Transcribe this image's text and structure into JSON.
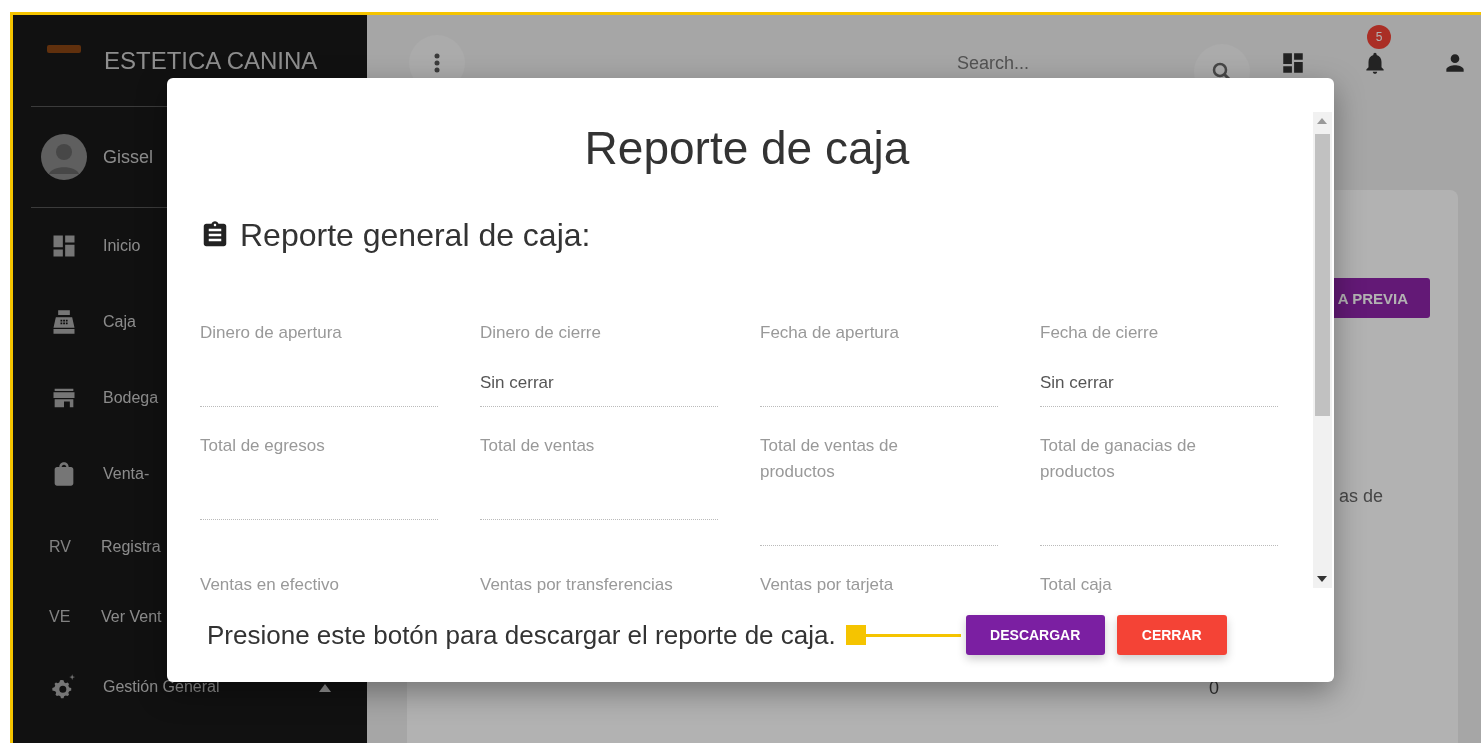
{
  "sidebar": {
    "brand": "ESTETICA CANINA",
    "user": "Gissel",
    "items": [
      {
        "kind": "icon",
        "label": "Inicio"
      },
      {
        "kind": "icon",
        "label": "Caja"
      },
      {
        "kind": "icon",
        "label": "Bodega"
      },
      {
        "kind": "icon",
        "label": "Venta-"
      },
      {
        "kind": "abbr",
        "abbr": "RV",
        "label": "Registra"
      },
      {
        "kind": "abbr",
        "abbr": "VE",
        "label": "Ver Vent"
      },
      {
        "kind": "icon",
        "label": "Gestión General",
        "expanded": true
      }
    ]
  },
  "topbar": {
    "search": {
      "placeholder": "Search..."
    },
    "notifications": "5"
  },
  "background": {
    "preview_button": "A PREVIA",
    "fragment_text": "as de",
    "value": "0"
  },
  "dialog": {
    "title": "Reporte de caja",
    "section_title": "Reporte general de caja:",
    "fields": [
      {
        "label": "Dinero de apertura"
      },
      {
        "label": "Dinero de cierre",
        "value": "Sin cerrar"
      },
      {
        "label": "Fecha de apertura"
      },
      {
        "label": "Fecha de cierre",
        "value": "Sin cerrar"
      },
      {
        "label": "Total de egresos"
      },
      {
        "label": "Total de ventas"
      },
      {
        "label": "Total de ventas de productos"
      },
      {
        "label": "Total de ganacias de productos"
      },
      {
        "label": "Ventas en efectivo"
      },
      {
        "label": "Ventas por transferencias"
      },
      {
        "label": "Ventas por tarjeta"
      },
      {
        "label": "Total caja"
      }
    ],
    "footer_text": "Presione este botón para descargar el reporte de caja.",
    "buttons": [
      {
        "label": "DESCARGAR",
        "kind": "primary"
      },
      {
        "label": "CERRAR",
        "kind": "danger"
      }
    ]
  }
}
